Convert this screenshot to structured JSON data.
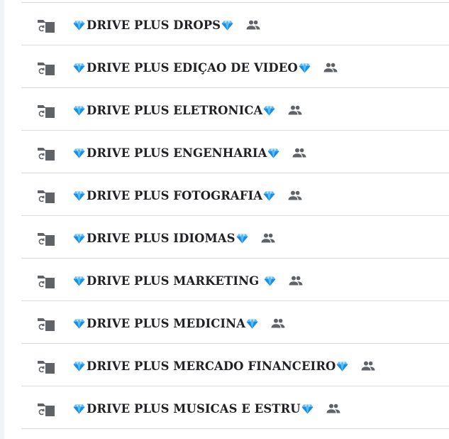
{
  "folders": [
    {
      "name": "DRIVE PLUS DROPS",
      "shared": true
    },
    {
      "name": "DRIVE PLUS EDIÇAO DE VIDEO",
      "shared": true
    },
    {
      "name": "DRIVE PLUS ELETRONICA",
      "shared": true
    },
    {
      "name": "DRIVE PLUS ENGENHARIA",
      "shared": true
    },
    {
      "name": "DRIVE PLUS FOTOGRAFIA",
      "shared": true
    },
    {
      "name": "DRIVE PLUS IDIOMAS",
      "shared": true
    },
    {
      "name": "DRIVE PLUS MARKETING ",
      "shared": true
    },
    {
      "name": "DRIVE PLUS MEDICINA",
      "shared": true
    },
    {
      "name": "DRIVE PLUS MERCADO FINANCEIRO",
      "shared": true
    },
    {
      "name": "DRIVE PLUS MUSICAS E ESTRU",
      "shared": true
    }
  ],
  "icons": {
    "folder": "shared-folder-icon",
    "gem": "diamond-emoji-icon",
    "shared": "people-icon"
  },
  "colors": {
    "text": "#202124",
    "icon": "#5f6368",
    "divider": "#dadce0",
    "gem_light": "#8fd3ff",
    "gem_dark": "#1a73e8"
  }
}
